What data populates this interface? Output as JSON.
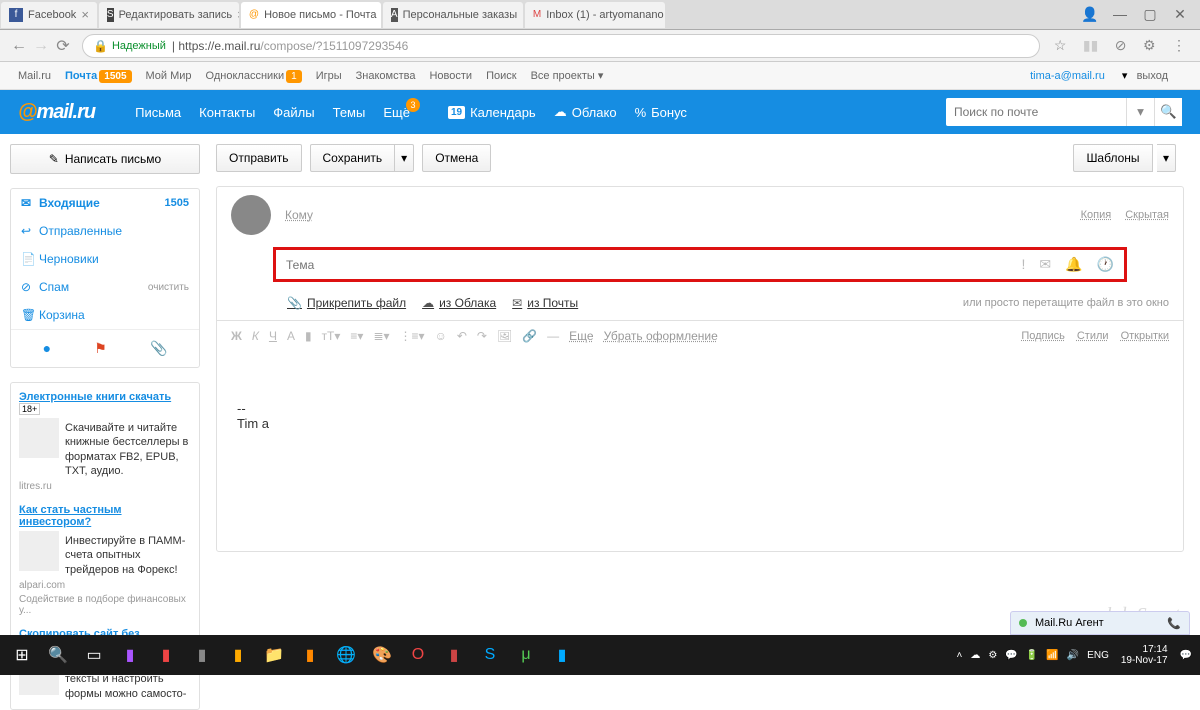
{
  "browser": {
    "tabs": [
      {
        "icon": "f",
        "label": "Facebook"
      },
      {
        "icon": "S",
        "label": "Редактировать запись"
      },
      {
        "icon": "@",
        "label": "Новое письмо - Почта",
        "active": true
      },
      {
        "icon": "A",
        "label": "Персональные заказы"
      },
      {
        "icon": "M",
        "label": "Inbox (1) - artyomanano"
      }
    ],
    "url_secure": "Надежный",
    "url_host": "https://e.mail.ru",
    "url_path": "/compose/?1511097293546"
  },
  "mailru_top": {
    "links": [
      "Mail.ru",
      "Почта",
      "Мой Мир",
      "Одноклассники",
      "Игры",
      "Знакомства",
      "Новости",
      "Поиск",
      "Все проекты"
    ],
    "mail_badge": "1505",
    "ok_badge": "1",
    "user": "tima-a@mail.ru",
    "logout": "выход"
  },
  "blue_header": {
    "logo": "mail.ru",
    "nav": [
      "Письма",
      "Контакты",
      "Файлы",
      "Темы",
      "Ещё"
    ],
    "more_badge": "3",
    "extras": [
      {
        "icon": "📅",
        "label": "Календарь",
        "pre": "19"
      },
      {
        "icon": "☁",
        "label": "Облако"
      },
      {
        "icon": "%",
        "label": "Бонус"
      }
    ],
    "search_placeholder": "Поиск по почте"
  },
  "sidebar": {
    "compose": "Написать письмо",
    "folders": [
      {
        "icon": "✉",
        "label": "Входящие",
        "count": "1505",
        "bold": true
      },
      {
        "icon": "↩",
        "label": "Отправленные"
      },
      {
        "icon": "📄",
        "label": "Черновики"
      },
      {
        "icon": "🗑",
        "label": "Спам",
        "action": "очистить"
      },
      {
        "icon": "🗑",
        "label": "Корзина"
      }
    ]
  },
  "ads": [
    {
      "title": "Электронные книги скачать",
      "badge": "18+",
      "desc": "Скачивайте и читайте книжные бестселлеры в форматах FB2, EPUB, TXT, аудио.",
      "src": "litres.ru"
    },
    {
      "title": "Как стать частным инвестором?",
      "desc": "Инвестируйте в ПАММ-счета опытных трейдеров на Форекс!",
      "src": "alpari.com",
      "sub": "Содействие в подборе финансовых у..."
    },
    {
      "title": "Скопировать сайт без фрилансеров?",
      "desc": "Это реально! Изменить тексты и настроить формы можно самосто-"
    }
  ],
  "toolbar": {
    "send": "Отправить",
    "save": "Сохранить",
    "cancel": "Отмена",
    "templates": "Шаблоны"
  },
  "compose": {
    "to_label": "Кому",
    "copy": "Копия",
    "hidden": "Скрытая",
    "subject_placeholder": "Тема",
    "attach_file": "Прикрепить файл",
    "from_cloud": "из Облака",
    "from_mail": "из Почты",
    "drag_hint": "или просто перетащите файл в это окно",
    "more": "Еще",
    "remove_format": "Убрать оформление",
    "sign": "Подпись",
    "styles": "Стили",
    "cards": "Открытки",
    "body_sig": "--",
    "body_name": "Tim a"
  },
  "agent": "Mail.Ru Агент",
  "taskbar": {
    "lang": "ENG",
    "time": "17:14",
    "date": "19-Nov-17"
  },
  "watermark": "club Sovet"
}
